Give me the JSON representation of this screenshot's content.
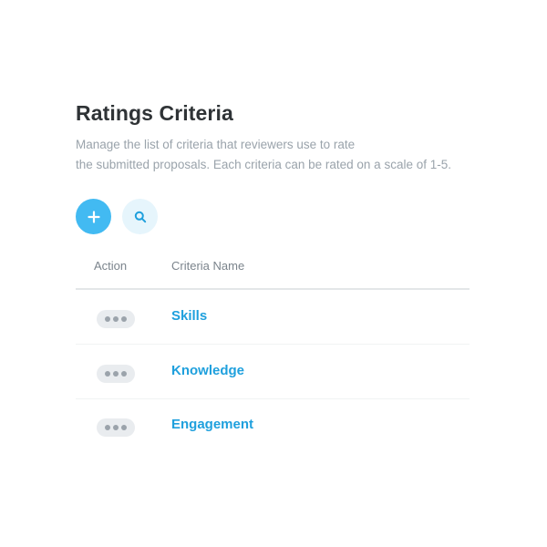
{
  "header": {
    "title": "Ratings Criteria",
    "description_line1": "Manage the list of criteria that reviewers use to rate",
    "description_line2": "the submitted proposals. Each criteria can be rated on a scale of 1-5."
  },
  "toolbar": {
    "add_icon": "plus-icon",
    "search_icon": "search-icon"
  },
  "table": {
    "columns": [
      "Action",
      "Criteria Name"
    ],
    "rows": [
      {
        "action_icon": "more-dots-icon",
        "name": "Skills"
      },
      {
        "action_icon": "more-dots-icon",
        "name": "Knowledge"
      },
      {
        "action_icon": "more-dots-icon",
        "name": "Engagement"
      }
    ]
  },
  "colors": {
    "accent": "#42baf2",
    "accent_light": "#e6f5fc",
    "link": "#1fa0dd",
    "title": "#2f3336",
    "muted": "#9aa3ab"
  }
}
